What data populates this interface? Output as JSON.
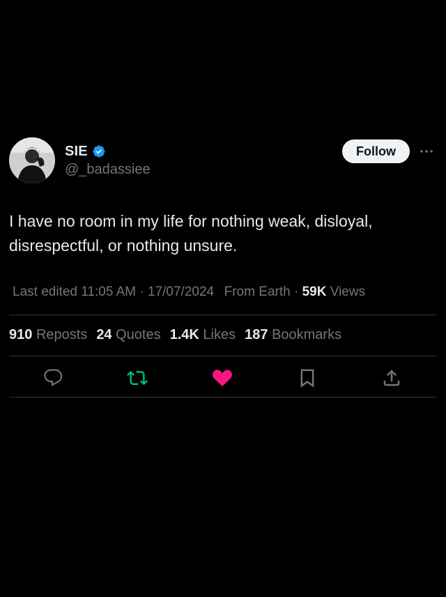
{
  "user": {
    "display_name": "SIE",
    "handle": "@_badassiee",
    "verified": true
  },
  "header": {
    "follow_label": "Follow",
    "more_icon": "more-horizontal-icon"
  },
  "tweet": {
    "text": "I have no room in my life for nothing weak, disloyal, disrespectful, or nothing unsure."
  },
  "meta": {
    "edited_label": "Last edited",
    "time": "11:05 AM",
    "separator": "·",
    "date": "17/07/2024",
    "source": "From Earth",
    "views_count": "59K",
    "views_label": "Views"
  },
  "stats": [
    {
      "count": "910",
      "label": "Reposts"
    },
    {
      "count": "24",
      "label": "Quotes"
    },
    {
      "count": "1.4K",
      "label": "Likes"
    },
    {
      "count": "187",
      "label": "Bookmarks"
    }
  ],
  "actions": {
    "reply_icon": "reply-icon",
    "repost_icon": "repost-icon",
    "like_icon": "like-icon",
    "bookmark_icon": "bookmark-icon",
    "share_icon": "share-icon"
  },
  "colors": {
    "background": "#000000",
    "text_primary": "#e7e9ea",
    "text_secondary": "#71767b",
    "verified": "#1d9bf0",
    "repost_active": "#00ba7c",
    "like_active": "#f91880",
    "divider": "#2f3336"
  }
}
